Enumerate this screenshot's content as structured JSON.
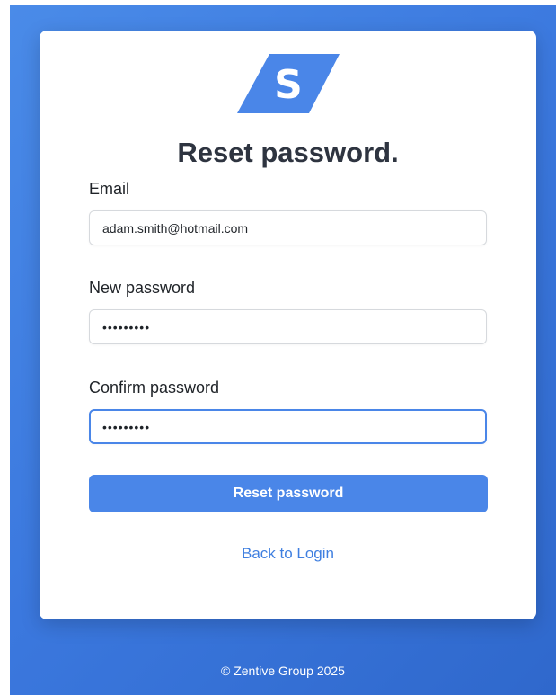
{
  "app": {
    "logo_letter": "S",
    "brand_color": "#4a86e8"
  },
  "form": {
    "title": "Reset password.",
    "email": {
      "label": "Email",
      "value": "adam.smith@hotmail.com"
    },
    "new_password": {
      "label": "New password",
      "value": "123456789"
    },
    "confirm_password": {
      "label": "Confirm password",
      "value": "123456789",
      "focused": true
    },
    "submit_label": "Reset password",
    "back_link_label": "Back to Login"
  },
  "footer": {
    "text": "© Zentive Group 2025"
  }
}
